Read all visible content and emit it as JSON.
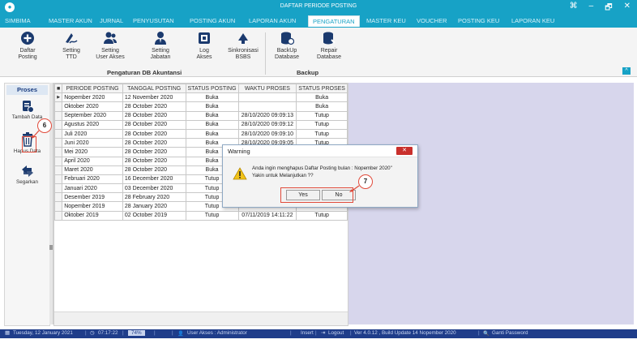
{
  "window": {
    "title": "DAFTAR PERIODE POSTING",
    "controls": [
      "⌘",
      "–",
      "🗗",
      "✕"
    ]
  },
  "menu": [
    {
      "label": "SIMBIMA",
      "active": false
    },
    {
      "label": "MASTER AKUN",
      "active": false
    },
    {
      "label": "JURNAL",
      "active": false
    },
    {
      "label": "PENYUSUTAN",
      "active": false
    },
    {
      "label": "POSTING AKUN",
      "active": false
    },
    {
      "label": "LAPORAN AKUN",
      "active": false
    },
    {
      "label": "PENGATURAN",
      "active": true
    },
    {
      "label": "MASTER KEU",
      "active": false
    },
    {
      "label": "VOUCHER",
      "active": false
    },
    {
      "label": "POSTING KEU",
      "active": false
    },
    {
      "label": "LAPORAN KEU",
      "active": false
    }
  ],
  "ribbon": {
    "group1_label": "Pengaturan DB Akuntansi",
    "group2_label": "Backup",
    "buttons": [
      {
        "line1": "Daftar",
        "line2": "Posting",
        "icon": "plus-circle-icon"
      },
      {
        "line1": "Setting",
        "line2": "TTD",
        "icon": "signature-icon"
      },
      {
        "line1": "Setting",
        "line2": "User Akses",
        "icon": "users-icon"
      },
      {
        "line1": "Setting",
        "line2": "Jabatan",
        "icon": "user-tie-icon"
      },
      {
        "line1": "Log",
        "line2": "Akses",
        "icon": "log-icon"
      },
      {
        "line1": "Sinkronisasi",
        "line2": "BSBS",
        "icon": "cloud-sync-icon"
      },
      {
        "line1": "BackUp",
        "line2": "Database",
        "icon": "database-backup-icon"
      },
      {
        "line1": "Repair",
        "line2": "Database",
        "icon": "database-repair-icon"
      }
    ]
  },
  "sidebar": {
    "header": "Proses",
    "items": [
      {
        "label": "Tambah Data",
        "icon": "add-document-icon"
      },
      {
        "label": "Hapus Data",
        "icon": "trash-icon"
      },
      {
        "label": "Segarkan",
        "icon": "refresh-icon"
      }
    ]
  },
  "table": {
    "columns": [
      "PERIODE POSTING",
      "TANGGAL POSTING",
      "STATUS POSTING",
      "WAKTU PROSES",
      "STATUS PROSES"
    ],
    "rows": [
      [
        "Nopember 2020",
        "12 November 2020",
        "Buka",
        "",
        "Buka"
      ],
      [
        "Oktober 2020",
        "28 October 2020",
        "Buka",
        "",
        "Buka"
      ],
      [
        "September 2020",
        "28 October 2020",
        "Buka",
        "28/10/2020 09:09:13",
        "Tutup"
      ],
      [
        "Agustus 2020",
        "28 October 2020",
        "Buka",
        "28/10/2020 09:09:12",
        "Tutup"
      ],
      [
        "Juli 2020",
        "28 October 2020",
        "Buka",
        "28/10/2020 09:09:10",
        "Tutup"
      ],
      [
        "Juni 2020",
        "28 October 2020",
        "Buka",
        "28/10/2020 09:09:05",
        "Tutup"
      ],
      [
        "Mei 2020",
        "28 October 2020",
        "Buka",
        "",
        ""
      ],
      [
        "April 2020",
        "28 October 2020",
        "Buka",
        "",
        ""
      ],
      [
        "Maret 2020",
        "28 October 2020",
        "Buka",
        "",
        ""
      ],
      [
        "Februari 2020",
        "16 December 2020",
        "Tutup",
        "",
        ""
      ],
      [
        "Januari 2020",
        "03 December 2020",
        "Tutup",
        "",
        ""
      ],
      [
        "Desember 2019",
        "28 February 2020",
        "Tutup",
        "",
        ""
      ],
      [
        "Nopember 2019",
        "28 January 2020",
        "Tutup",
        "",
        ""
      ],
      [
        "Oktober 2019",
        "02 October 2019",
        "Tutup",
        "07/11/2019 14:11:22",
        "Tutup"
      ]
    ]
  },
  "dialog": {
    "title": "Warning",
    "close": "✕",
    "message_line1": "Anda ingin menghapus Daftar Posting bulan : Nopember 2020\"",
    "message_line2": "Yakin untuk Melanjutkan ??",
    "yes": "Yes",
    "no": "No"
  },
  "callouts": {
    "step6": "6",
    "step7": "7"
  },
  "status": {
    "date": "Tuesday, 12 January 2021",
    "time": "07:17:22",
    "progress": "74%",
    "user": "User Akses : Administrator",
    "mode": "Insert",
    "logout": "Logout",
    "version": "Ver 4.0.12 , Build Update 14 Nopember 2020",
    "password": "Ganti Password"
  },
  "colors": {
    "accent": "#17a2c6",
    "status_bg": "#1f3d8a",
    "dialog_close": "#c9302c",
    "callout": "#e04a3a",
    "right_panel": "#d7d6ec"
  }
}
